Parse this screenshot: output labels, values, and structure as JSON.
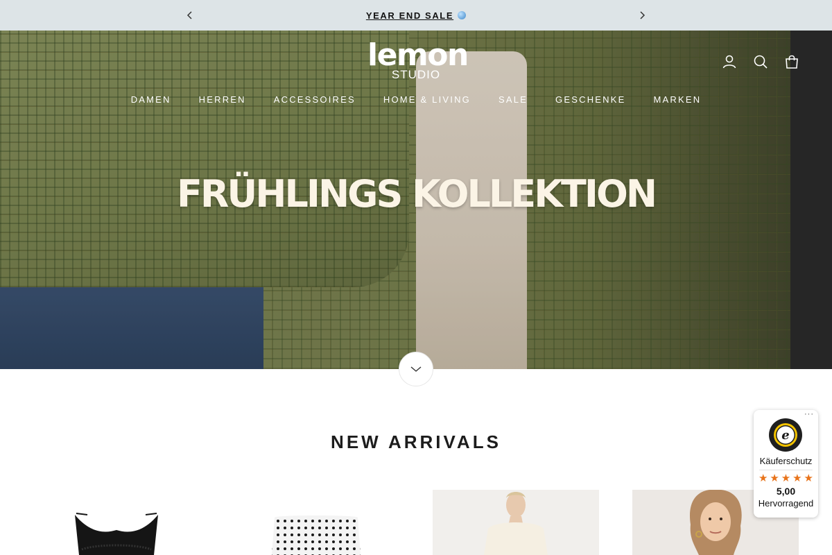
{
  "announcement": {
    "text": "YEAR END SALE"
  },
  "header": {
    "logo_word": "lemon",
    "logo_sub": "STUDIO",
    "icons": [
      "account-icon",
      "search-icon",
      "cart-icon"
    ]
  },
  "nav": {
    "items": [
      "DAMEN",
      "HERREN",
      "ACCESSOIRES",
      "HOME & LIVING",
      "SALE",
      "GESCHENKE",
      "MARKEN"
    ]
  },
  "hero": {
    "title": "FRÜHLINGS KOLLEKTION"
  },
  "section": {
    "title": "NEW ARRIVALS"
  },
  "trusted": {
    "more": "···",
    "label": "Käuferschutz",
    "stars": 5,
    "score": "5,00",
    "rating": "Hervorragend"
  },
  "colors": {
    "announcement_bg": "#dde4e7",
    "star": "#e8731a"
  }
}
